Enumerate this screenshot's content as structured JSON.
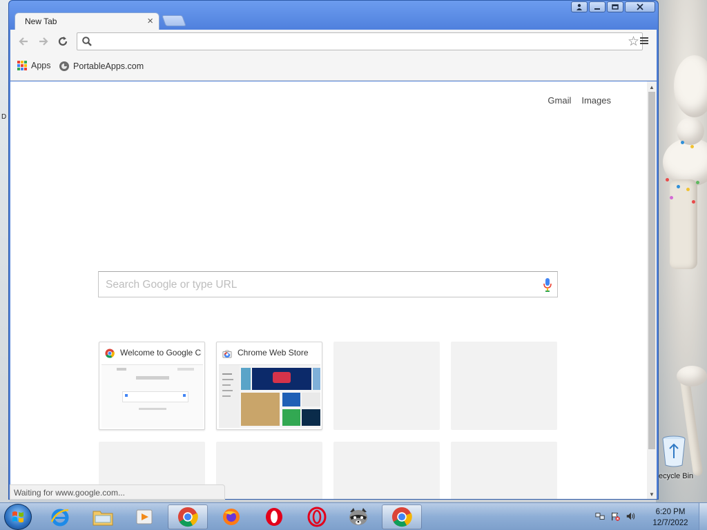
{
  "window": {
    "tab_title": "New Tab",
    "tab_close": "×"
  },
  "omnibox": {
    "value": "",
    "placeholder": ""
  },
  "bookmarks": [
    {
      "label": "Apps",
      "icon": "apps-grid-icon"
    },
    {
      "label": "PortableApps.com",
      "icon": "portableapps-icon"
    }
  ],
  "top_links": {
    "gmail": "Gmail",
    "images": "Images"
  },
  "search": {
    "placeholder": "Search Google or type URL"
  },
  "tiles": [
    {
      "title": "Welcome to Google Chrome",
      "favicon": "chrome-icon",
      "filled": true
    },
    {
      "title": "Chrome Web Store",
      "favicon": "webstore-icon",
      "filled": true
    },
    {
      "title": "",
      "filled": false
    },
    {
      "title": "",
      "filled": false
    },
    {
      "title": "",
      "filled": false
    },
    {
      "title": "",
      "filled": false
    },
    {
      "title": "",
      "filled": false
    },
    {
      "title": "",
      "filled": false
    }
  ],
  "status": {
    "text": "Waiting for www.google.com..."
  },
  "desktop": {
    "recycle_bin_label": "ecycle Bin",
    "edge_letter": "D"
  },
  "taskbar": {
    "apps": [
      {
        "name": "internet-explorer",
        "active": false
      },
      {
        "name": "file-explorer",
        "active": false
      },
      {
        "name": "media-player",
        "active": false
      },
      {
        "name": "chrome",
        "active": true
      },
      {
        "name": "firefox",
        "active": false
      },
      {
        "name": "opera",
        "active": false
      },
      {
        "name": "opera-alt",
        "active": false
      },
      {
        "name": "raccoon-app",
        "active": false
      },
      {
        "name": "chrome-2",
        "active": true
      }
    ],
    "clock_time": "6:20 PM",
    "clock_date": "12/7/2022"
  },
  "colors": {
    "frame_blue": "#4f7fd6",
    "taskbar_blue": "#8eaed6",
    "google_blue": "#4285f4",
    "google_red": "#ea4335",
    "google_yellow": "#fbbc05",
    "google_green": "#34a853"
  }
}
